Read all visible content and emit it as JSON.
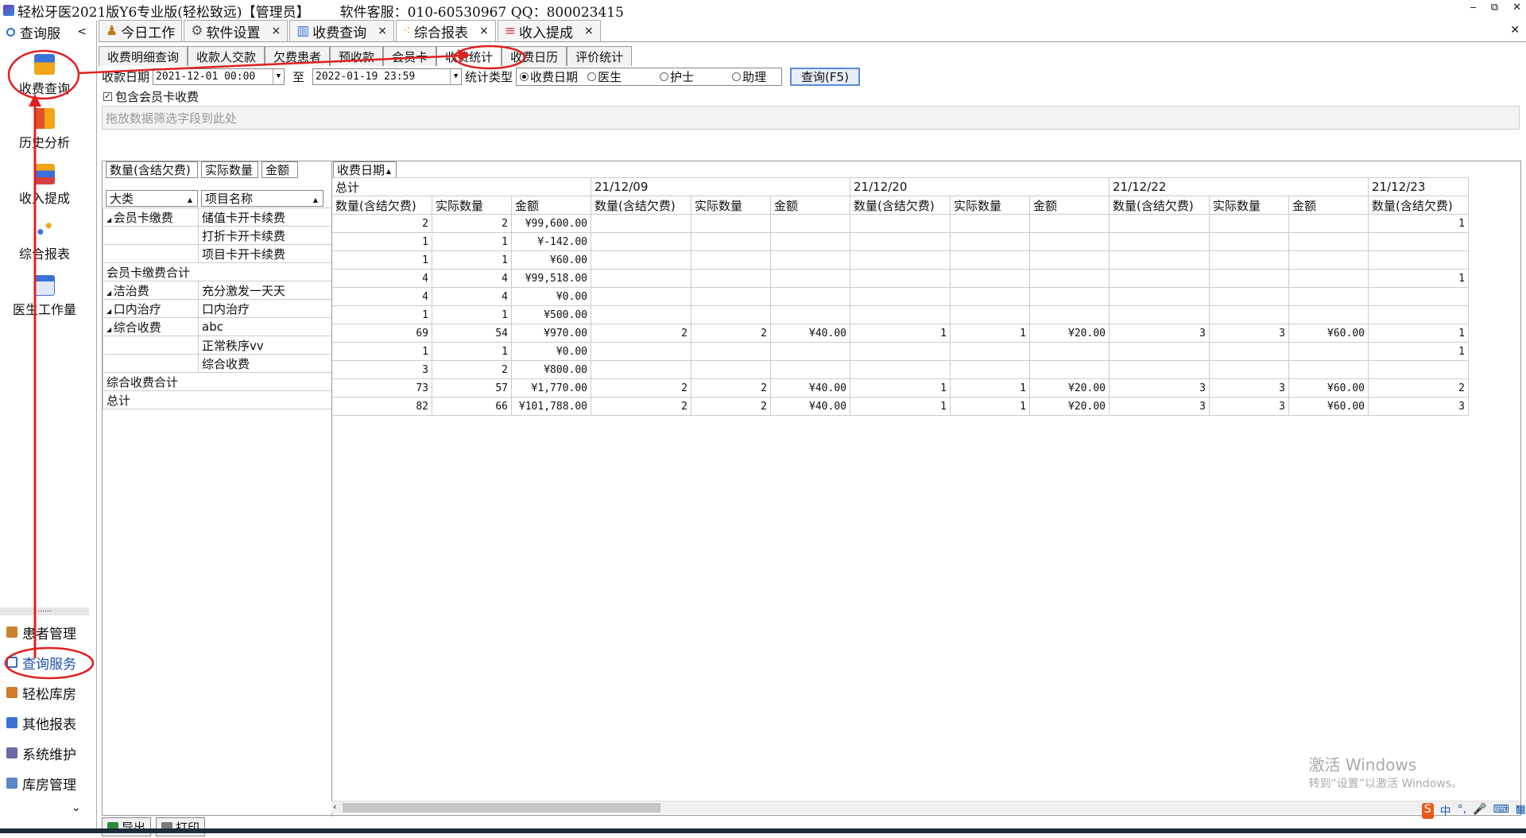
{
  "window": {
    "title": "轻松牙医2021版Y6专业版(轻松致远)【管理员】",
    "service": "软件客服：010-60530967 QQ：800023415",
    "min": "‒",
    "restore": "⧉",
    "close": "✕"
  },
  "sidebar": {
    "header": "查询服",
    "chevron": "<",
    "items": [
      {
        "label": "收费查询",
        "icon": "chart-search-icon"
      },
      {
        "label": "历史分析",
        "icon": "bar-chart-icon"
      },
      {
        "label": "收入提成",
        "icon": "stack-chart-icon"
      },
      {
        "label": "综合报表",
        "icon": "scatter-icon"
      },
      {
        "label": "医生工作量",
        "icon": "doctor-calendar-icon"
      }
    ],
    "divider": "......",
    "bottom": [
      {
        "label": "患者管理",
        "icon": "patients-icon"
      },
      {
        "label": "查询服务",
        "icon": "query-icon"
      },
      {
        "label": "轻松库房",
        "icon": "warehouse-icon"
      },
      {
        "label": "其他报表",
        "icon": "report-icon"
      },
      {
        "label": "系统维护",
        "icon": "maintenance-icon"
      },
      {
        "label": "库房管理",
        "icon": "storage-icon"
      }
    ],
    "more": "⌄"
  },
  "tabs": [
    {
      "label": "今日工作",
      "active": false
    },
    {
      "label": "软件设置",
      "active": false
    },
    {
      "label": "收费查询",
      "active": false
    },
    {
      "label": "综合报表",
      "active": true
    },
    {
      "label": "收入提成",
      "active": false
    }
  ],
  "tab_close": "×",
  "subtabs": [
    "收费明细查询",
    "收款人交款",
    "欠费患者",
    "预收款",
    "会员卡",
    "收费统计",
    "收费日历",
    "评价统计"
  ],
  "filter": {
    "date_label": "收款日期",
    "from": "2021-12-01 00:00",
    "to_label": "至",
    "to": "2022-01-19 23:59",
    "type_label": "统计类型",
    "radios": [
      {
        "label": "收费日期",
        "checked": true
      },
      {
        "label": "医生",
        "checked": false
      },
      {
        "label": "护士",
        "checked": false
      },
      {
        "label": "助理",
        "checked": false
      }
    ],
    "query_button": "查询(F5)"
  },
  "include_member": {
    "label": "包含会员卡收费",
    "checked": "✓"
  },
  "dropzone": "拖放数据筛选字段到此处",
  "pivot": {
    "data_fields": [
      "数量(含结欠费)",
      "实际数量",
      "金额"
    ],
    "column_field": "收费日期",
    "row_fields": [
      "大类",
      "项目名称"
    ],
    "col_groups": [
      "总计",
      "21/12/09",
      "21/12/20",
      "21/12/22",
      "21/12/23"
    ],
    "measures": [
      "数量(含结欠费)",
      "实际数量",
      "金额"
    ],
    "rows": [
      {
        "cat": "会员卡缴费",
        "item": "储值卡开卡续费",
        "v": [
          "2",
          "2",
          "¥99,600.00",
          "",
          "",
          "",
          "",
          "",
          "",
          "",
          "",
          "",
          "1"
        ]
      },
      {
        "cat": "",
        "item": "打折卡开卡续费",
        "v": [
          "1",
          "1",
          "¥-142.00",
          "",
          "",
          "",
          "",
          "",
          "",
          "",
          "",
          "",
          ""
        ]
      },
      {
        "cat": "",
        "item": "项目卡开卡续费",
        "v": [
          "1",
          "1",
          "¥60.00",
          "",
          "",
          "",
          "",
          "",
          "",
          "",
          "",
          "",
          ""
        ]
      },
      {
        "total": "会员卡缴费合计",
        "v": [
          "4",
          "4",
          "¥99,518.00",
          "",
          "",
          "",
          "",
          "",
          "",
          "",
          "",
          "",
          "1"
        ]
      },
      {
        "cat": "洁治费",
        "item": "充分激发一天天",
        "v": [
          "4",
          "4",
          "¥0.00",
          "",
          "",
          "",
          "",
          "",
          "",
          "",
          "",
          "",
          ""
        ]
      },
      {
        "cat": "口内治疗",
        "item": "口内治疗",
        "v": [
          "1",
          "1",
          "¥500.00",
          "",
          "",
          "",
          "",
          "",
          "",
          "",
          "",
          "",
          ""
        ]
      },
      {
        "cat": "综合收费",
        "item": "abc",
        "v": [
          "69",
          "54",
          "¥970.00",
          "2",
          "2",
          "¥40.00",
          "1",
          "1",
          "¥20.00",
          "3",
          "3",
          "¥60.00",
          "1"
        ]
      },
      {
        "cat": "",
        "item": "正常秩序vv",
        "v": [
          "1",
          "1",
          "¥0.00",
          "",
          "",
          "",
          "",
          "",
          "",
          "",
          "",
          "",
          "1"
        ]
      },
      {
        "cat": "",
        "item": "综合收费",
        "v": [
          "3",
          "2",
          "¥800.00",
          "",
          "",
          "",
          "",
          "",
          "",
          "",
          "",
          "",
          ""
        ]
      },
      {
        "total": "综合收费合计",
        "v": [
          "73",
          "57",
          "¥1,770.00",
          "2",
          "2",
          "¥40.00",
          "1",
          "1",
          "¥20.00",
          "3",
          "3",
          "¥60.00",
          "2"
        ]
      },
      {
        "total": "总计",
        "v": [
          "82",
          "66",
          "¥101,788.00",
          "2",
          "2",
          "¥40.00",
          "1",
          "1",
          "¥20.00",
          "3",
          "3",
          "¥60.00",
          "3"
        ]
      }
    ]
  },
  "bottom": {
    "export": "导出",
    "print": "打印"
  },
  "watermark": {
    "line1": "激活 Windows",
    "line2": "转到“设置”以激活 Windows。"
  },
  "tray": {
    "ime": "中",
    "punct": "°,",
    "mic": "🎤",
    "keyboard": "⌨",
    "grid": "▦"
  },
  "colors": {
    "annotation": "#e02020",
    "accent": "#2f6fd0"
  }
}
